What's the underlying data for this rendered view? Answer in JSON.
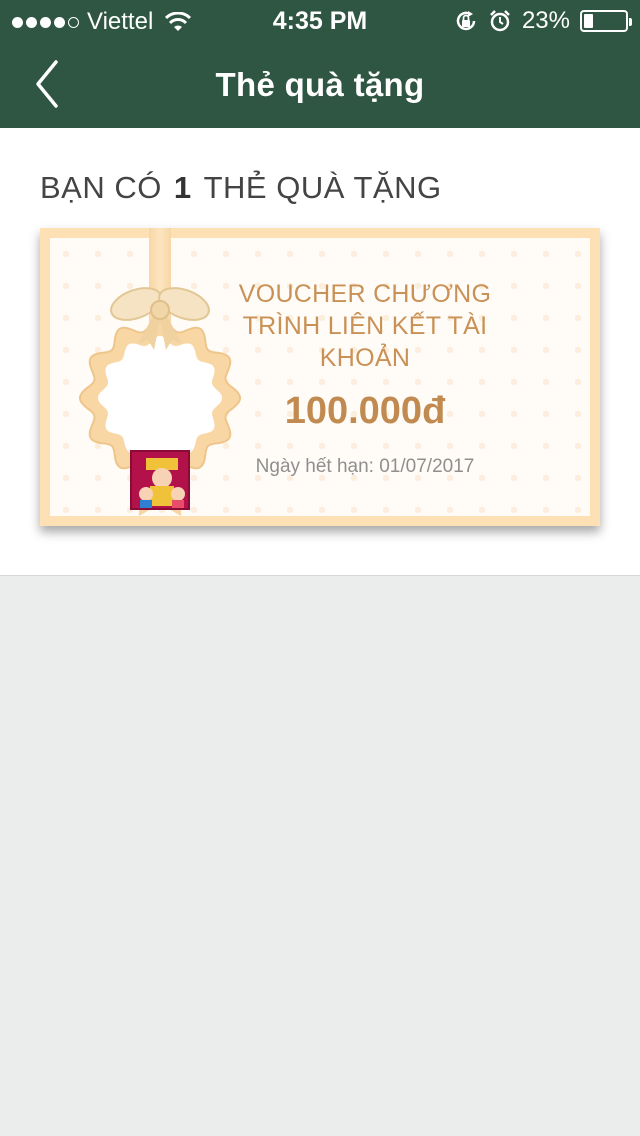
{
  "status_bar": {
    "carrier": "Viettel",
    "time": "4:35 PM",
    "battery_percent": "23%",
    "battery_level": 0.23,
    "icons": [
      "signal-dots-icon",
      "wifi-icon",
      "orientation-lock-icon",
      "alarm-icon",
      "battery-icon"
    ]
  },
  "nav": {
    "title": "Thẻ quà tặng",
    "back_icon": "chevron-left-icon"
  },
  "summary": {
    "prefix": "BẠN CÓ",
    "count": "1",
    "suffix": "THẺ QUÀ TẶNG"
  },
  "vouchers": [
    {
      "title": "VOUCHER CHƯƠNG TRÌNH LIÊN KẾT TÀI KHOẢN",
      "value": "100.000đ",
      "expiry": "Ngày hết hạn: 01/07/2017"
    }
  ],
  "colors": {
    "header": "#2f5543",
    "voucher_accent": "#c99155",
    "voucher_frame": "#fde0b4",
    "page_background": "#ebeded"
  }
}
